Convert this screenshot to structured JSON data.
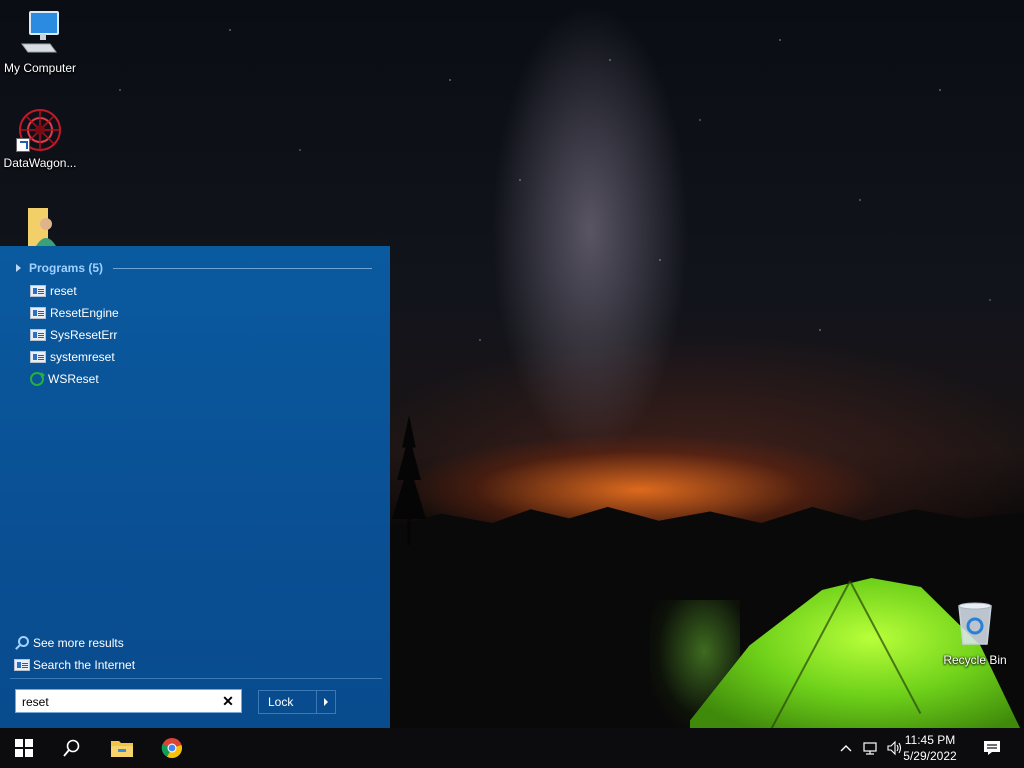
{
  "desktop": {
    "icons": [
      {
        "label": "My Computer"
      },
      {
        "label": "DataWagon..."
      },
      {
        "label": ""
      },
      {
        "label": "Recycle Bin"
      }
    ]
  },
  "start_menu": {
    "section_title": "Programs (5)",
    "results": [
      {
        "label": "reset",
        "icon": "exe-icon"
      },
      {
        "label": "ResetEngine",
        "icon": "exe-icon"
      },
      {
        "label": "SysResetErr",
        "icon": "exe-icon"
      },
      {
        "label": "systemreset",
        "icon": "exe-icon"
      },
      {
        "label": "WSReset",
        "icon": "wsreset-icon"
      }
    ],
    "see_more_results": "See more results",
    "search_internet": "Search the Internet",
    "search": {
      "value": "reset"
    },
    "lock_button": "Lock",
    "accent_color": "#0a4f93"
  },
  "taskbar": {
    "clock_time": "11:45 PM",
    "clock_date": "5/29/2022",
    "pinned": [
      "start-icon",
      "search-icon",
      "file-explorer-icon",
      "chrome-icon"
    ],
    "tray": [
      "chevron-up-icon",
      "network-icon",
      "volume-icon",
      "notifications-icon"
    ]
  }
}
